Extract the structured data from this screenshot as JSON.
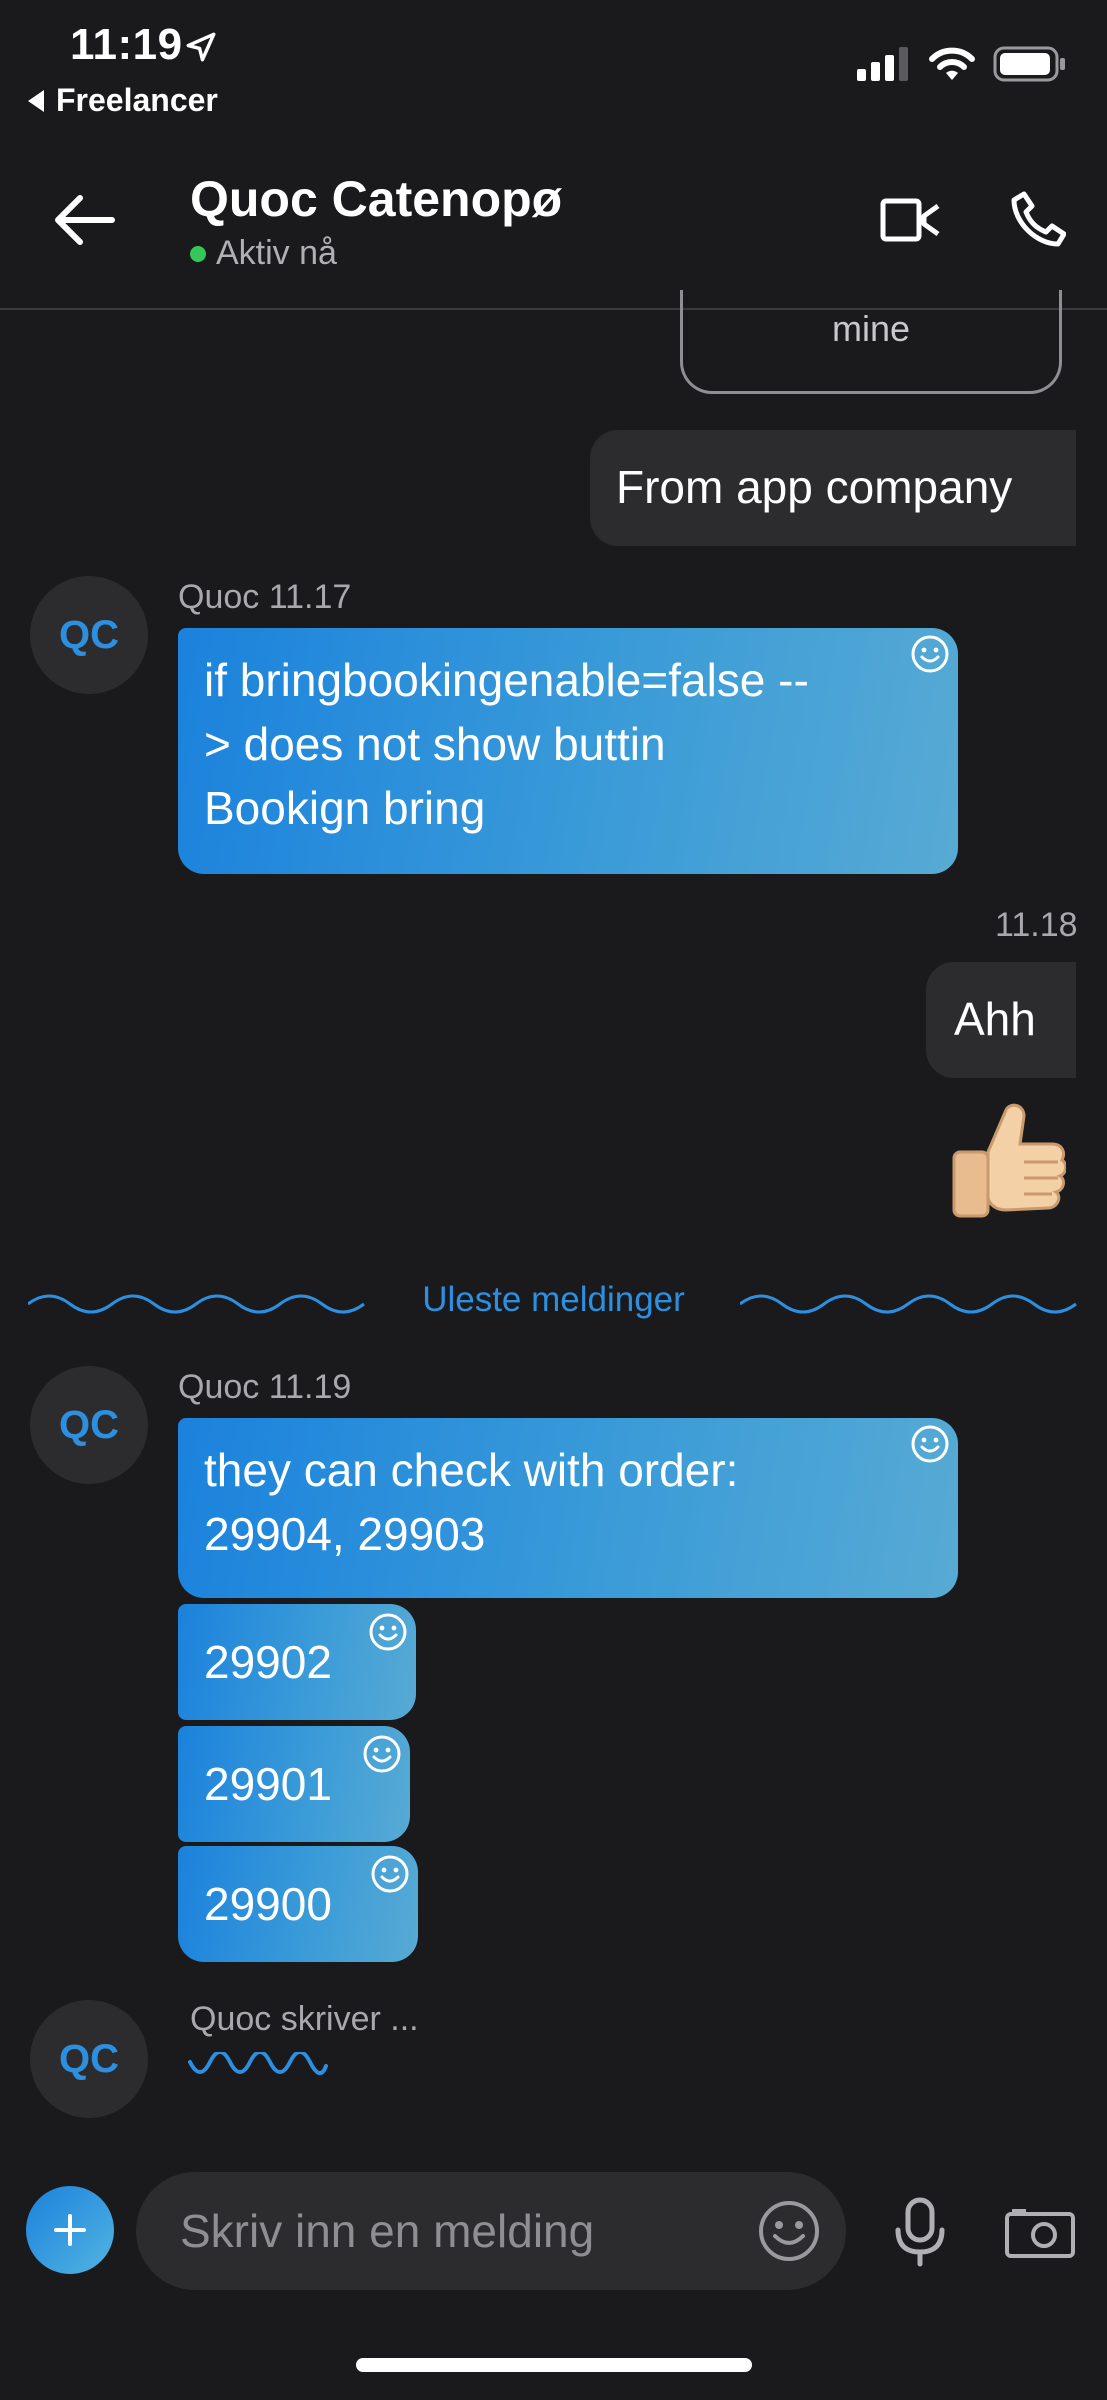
{
  "status_bar": {
    "time": "11:19",
    "back_app": "Freelancer"
  },
  "header": {
    "contact_name": "Quoc Catenopø",
    "contact_status": "Aktiv nå",
    "status_color": "#34c759"
  },
  "colors": {
    "accent": "#2d8fe0",
    "bubble_gradient_start": "#1b82dd",
    "bubble_gradient_end": "#57aad4",
    "outgoing_bubble": "#2c2c2e",
    "background": "#1a1a1c"
  },
  "messages": {
    "partial_card_text": "mine",
    "out_1": "From app company",
    "group_1": {
      "avatar": "QC",
      "meta": "Quoc 11.17",
      "lines": [
        "if bringbookingenable=false --",
        "> does not show buttin",
        "Bookign bring"
      ]
    },
    "out_2_time": "11.18",
    "out_2": "Ahh",
    "reaction_icon": "thumbs-up-icon",
    "unread_divider": "Uleste meldinger",
    "group_2": {
      "avatar": "QC",
      "meta": "Quoc 11.19",
      "lines": [
        "they can check with order:",
        "29904, 29903"
      ],
      "short_1": "29902",
      "short_2": "29901",
      "short_3": "29900"
    },
    "typing": {
      "avatar": "QC",
      "label": "Quoc skriver ..."
    }
  },
  "composer": {
    "placeholder": "Skriv inn en melding"
  }
}
